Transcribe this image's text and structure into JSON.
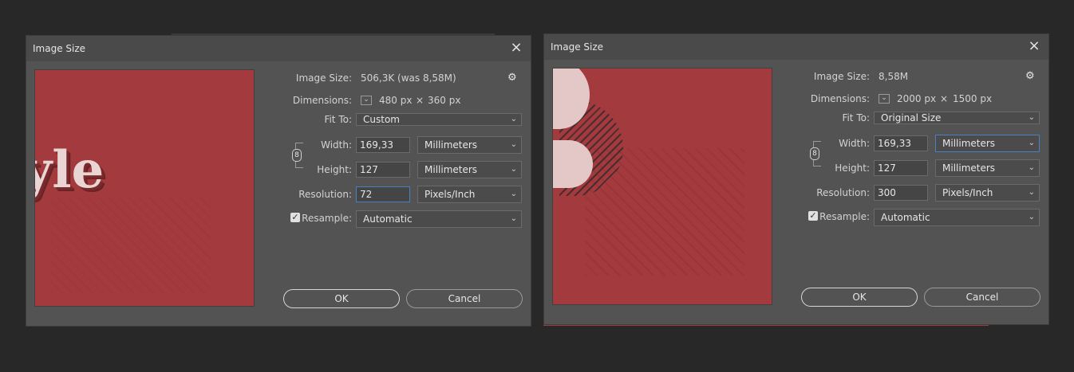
{
  "dialogs": [
    {
      "title": "Image Size",
      "preview_text": "yle",
      "image_size_label": "Image Size:",
      "image_size_value": "506,3K (was 8,58M)",
      "dimensions_label": "Dimensions:",
      "dimensions_w": "480 px",
      "dimensions_x": "×",
      "dimensions_h": "360 px",
      "fit_to_label": "Fit To:",
      "fit_to_value": "Custom",
      "width_label": "Width:",
      "width_value": "169,33",
      "width_unit": "Millimeters",
      "height_label": "Height:",
      "height_value": "127",
      "height_unit": "Millimeters",
      "resolution_label": "Resolution:",
      "resolution_value": "72",
      "resolution_unit": "Pixels/Inch",
      "resample_label": "Resample:",
      "resample_value": "Automatic",
      "ok_label": "OK",
      "cancel_label": "Cancel"
    },
    {
      "title": "Image Size",
      "image_size_label": "Image Size:",
      "image_size_value": "8,58M",
      "dimensions_label": "Dimensions:",
      "dimensions_w": "2000 px",
      "dimensions_x": "×",
      "dimensions_h": "1500 px",
      "fit_to_label": "Fit To:",
      "fit_to_value": "Original Size",
      "width_label": "Width:",
      "width_value": "169,33",
      "width_unit": "Millimeters",
      "height_label": "Height:",
      "height_value": "127",
      "height_unit": "Millimeters",
      "resolution_label": "Resolution:",
      "resolution_value": "300",
      "resolution_unit": "Pixels/Inch",
      "resample_label": "Resample:",
      "resample_value": "Automatic",
      "ok_label": "OK",
      "cancel_label": "Cancel"
    }
  ],
  "icons": {
    "close": "×",
    "gear": "⚙",
    "chevron": "⌄",
    "check": "✓",
    "chain": "8"
  },
  "colors": {
    "background": "#282828",
    "dialog": "#535353",
    "preview_red": "#a33a3d",
    "focus_blue": "#4a7fc1"
  }
}
